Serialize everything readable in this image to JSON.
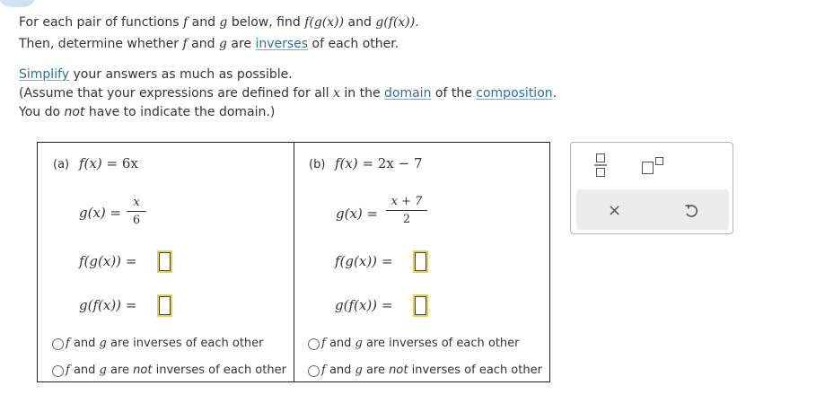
{
  "instructions": {
    "line1_a": "For each pair of functions ",
    "line1_f": "f",
    "line1_and": " and ",
    "line1_g": "g",
    "line1_b": " below, find ",
    "line1_fgx": "f(g(x))",
    "line1_and2": " and ",
    "line1_gfx": "g(f(x)).",
    "line2_a": "Then, determine whether ",
    "line2_f": "f",
    "line2_and": " and ",
    "line2_g": "g",
    "line2_b": " are ",
    "line2_link": "inverses",
    "line2_c": " of each other.",
    "line3_link": "Simplify",
    "line3_b": " your answers as much as possible.",
    "line4_a": "(Assume that your expressions are defined for all ",
    "line4_x": "x",
    "line4_b": " in the ",
    "line4_link1": "domain",
    "line4_c": " of the ",
    "line4_link2": "composition",
    "line4_d": ".",
    "line5_a": "You do ",
    "line5_not": "not",
    "line5_b": " have to indicate the domain.)"
  },
  "part_a": {
    "label": "(a)",
    "f_lhs": "f(x)",
    "f_eq": "=",
    "f_rhs": "6x",
    "g_lhs": "g(x)",
    "g_eq": "=",
    "g_num": "x",
    "g_den": "6",
    "fg_lhs": "f(g(x))",
    "fg_eq": "=",
    "gf_lhs": "g(f(x))",
    "gf_eq": "=",
    "opt1": {
      "f": "f",
      "and": " and ",
      "g": "g",
      "rest": " are inverses of each other"
    },
    "opt2": {
      "f": "f",
      "and": " and ",
      "g": "g",
      "are": " are ",
      "not": "not",
      "rest": " inverses of each other"
    }
  },
  "part_b": {
    "label": "(b)",
    "f_lhs": "f(x)",
    "f_eq": "=",
    "f_rhs": "2x − 7",
    "g_lhs": "g(x)",
    "g_eq": "=",
    "g_num": "x + 7",
    "g_den": "2",
    "fg_lhs": "f(g(x))",
    "fg_eq": "=",
    "gf_lhs": "g(f(x))",
    "gf_eq": "=",
    "opt1": {
      "f": "f",
      "and": " and ",
      "g": "g",
      "rest": " are inverses of each other"
    },
    "opt2": {
      "f": "f",
      "and": " and ",
      "g": "g",
      "are": " are ",
      "not": "not",
      "rest": " inverses of each other"
    }
  },
  "tools": {
    "fraction_icon": "fraction-icon",
    "exponent_icon": "exponent-icon",
    "clear_icon": "close-icon",
    "undo_icon": "undo-icon",
    "clear_glyph": "×"
  },
  "colors": {
    "link": "#2d6fa3",
    "answer_highlight": "#e6d34a",
    "tab": "#cfe3f3"
  }
}
